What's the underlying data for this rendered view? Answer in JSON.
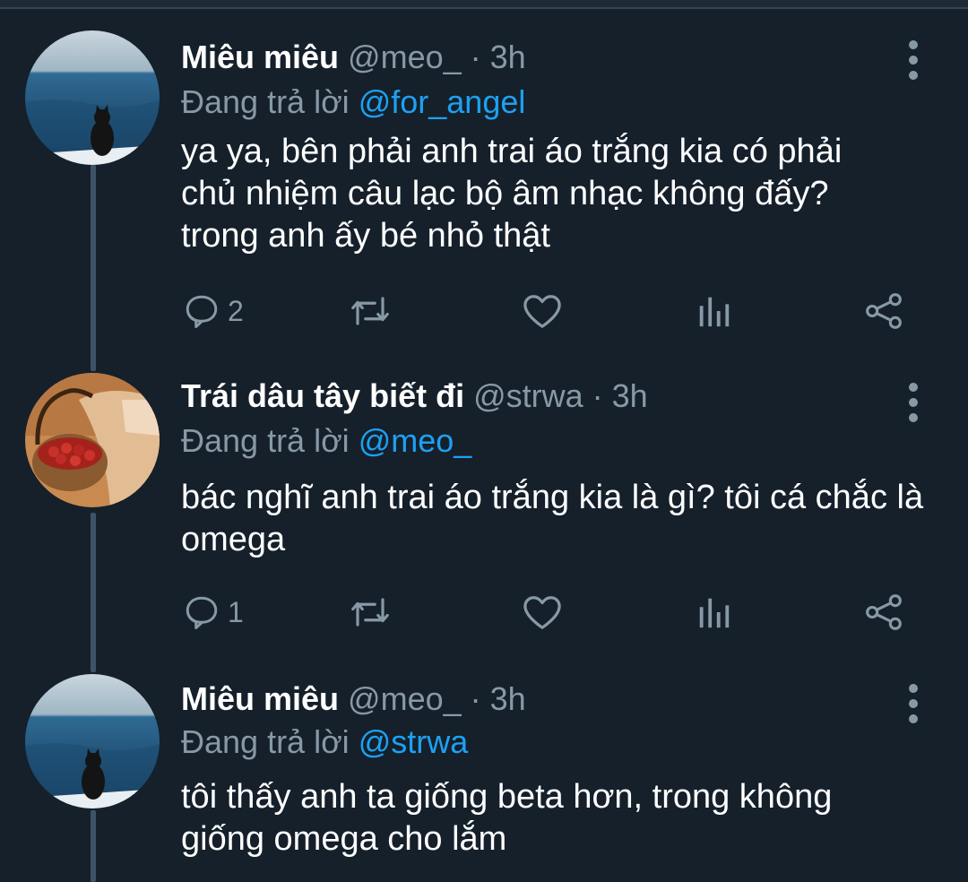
{
  "app": {
    "name": "Twitter"
  },
  "colors": {
    "background": "#15202b",
    "accent": "#1da1f2",
    "muted": "#8899a6",
    "thread_line": "#3d5466"
  },
  "tweets": [
    {
      "name": "Miêu miêu",
      "handle": "@meo_",
      "time": "· 3h",
      "replying_prefix": "Đang trả lời",
      "replying_to": "@for_angel",
      "text": "ya ya, bên phải anh trai áo trắng kia có phải chủ nhiệm câu lạc bộ âm nhạc không đấy? trong anh ấy bé nhỏ thật",
      "reply_count": "2",
      "avatar_icon": "cat-by-sea-avatar"
    },
    {
      "name": "Trái dâu tây biết đi",
      "handle": "@strwa",
      "time": "· 3h",
      "replying_prefix": "Đang trả lời",
      "replying_to": "@meo_",
      "text": "bác nghĩ anh trai áo trắng kia là gì? tôi cá chắc là omega",
      "reply_count": "1",
      "avatar_icon": "strawberry-basket-avatar"
    },
    {
      "name": "Miêu miêu",
      "handle": "@meo_",
      "time": "· 3h",
      "replying_prefix": "Đang trả lời",
      "replying_to": "@strwa",
      "text": "tôi thấy anh ta giống beta hơn, trong không giống omega cho lắm",
      "avatar_icon": "cat-by-sea-avatar"
    }
  ],
  "icons": [
    "reply-icon",
    "retweet-icon",
    "like-icon",
    "analytics-icon",
    "share-icon",
    "more-icon"
  ]
}
